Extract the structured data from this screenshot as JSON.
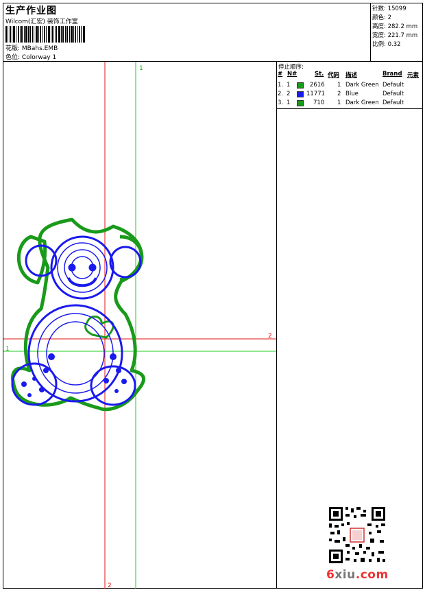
{
  "header": {
    "title": "生产作业图",
    "company": "Wilcom(汇宏) 装饰工作室",
    "design_label": "花版:",
    "design_value": "MBahs.EMB",
    "colorway_label": "色位:",
    "colorway_value": "Colorway 1"
  },
  "stats": {
    "stitches_label": "针数:",
    "stitches_value": "15099",
    "colors_label": "颜色:",
    "colors_value": "2",
    "height_label": "高度:",
    "height_value": "282.2 mm",
    "width_label": "宽度:",
    "width_value": "221.7 mm",
    "scale_label": "比例:",
    "scale_value": "0.32"
  },
  "canvas": {
    "guide_top_label": "1",
    "guide_left_label": "1",
    "guide_right_label": "2",
    "guide_bottom_label": "2",
    "colors": {
      "green": "#1a9a1a",
      "blue": "#1a1aee",
      "red_guide": "#e01010",
      "green_guide": "#22cc22"
    }
  },
  "stops": {
    "title": "停止顺序:",
    "headers": {
      "num": "#",
      "needle": "N#",
      "stitches": "St.",
      "code": "代码",
      "desc": "描述",
      "brand": "Brand",
      "element": "元素"
    },
    "rows": [
      {
        "num": "1.",
        "needle": "1",
        "color": "#1a9a1a",
        "stitches": "2616",
        "code": "1",
        "desc": "Dark Green",
        "brand": "Default"
      },
      {
        "num": "2.",
        "needle": "2",
        "color": "#1a1aee",
        "stitches": "11771",
        "code": "2",
        "desc": "Blue",
        "brand": "Default"
      },
      {
        "num": "3.",
        "needle": "1",
        "color": "#1a9a1a",
        "stitches": "710",
        "code": "1",
        "desc": "Dark Green",
        "brand": "Default"
      }
    ]
  },
  "watermark": {
    "part1": "6",
    "part2": "xiu",
    "part3": ".com"
  }
}
